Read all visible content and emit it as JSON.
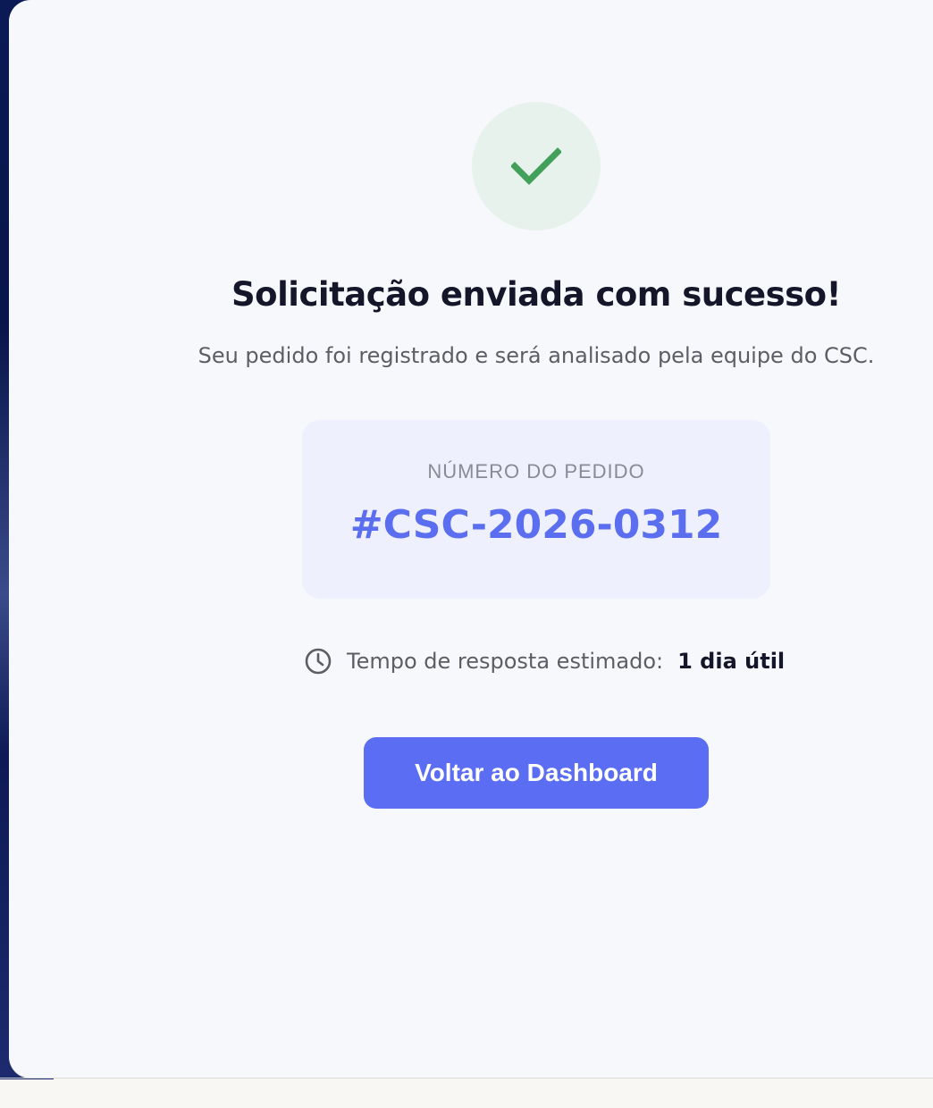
{
  "success": {
    "icon": "check-icon",
    "title": "Solicitação enviada com sucesso!",
    "message": "Seu pedido foi registrado e será analisado pela equipe do CSC."
  },
  "order": {
    "label": "NÚMERO DO PEDIDO",
    "number": "#CSC-2026-0312"
  },
  "eta": {
    "icon": "clock-icon",
    "label": "Tempo de resposta estimado:",
    "value": "1 dia útil"
  },
  "actions": {
    "back_label": "Voltar ao Dashboard"
  },
  "colors": {
    "accent": "#5b6ef3",
    "success": "#43a05a",
    "success_bg": "#e8f2ec",
    "card_bg": "#eef1fd"
  }
}
